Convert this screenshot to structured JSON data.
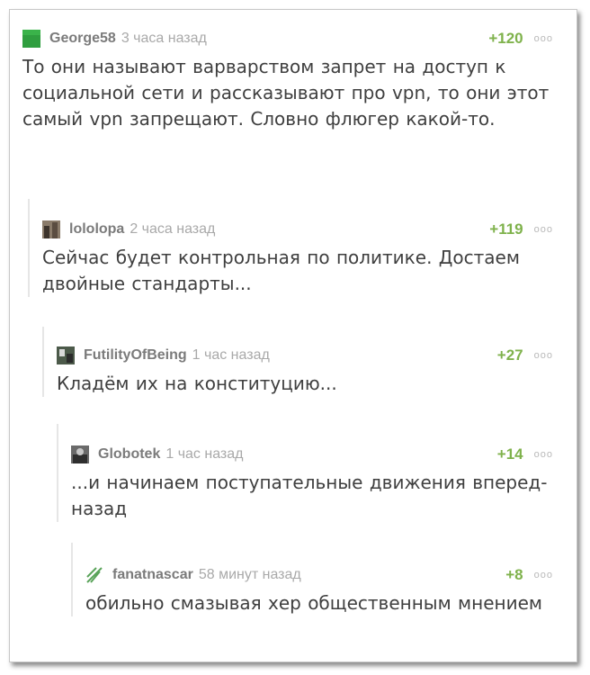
{
  "comments": [
    {
      "author": "George58",
      "time": "3 часа назад",
      "rating": "+120",
      "more_icon": "ooo",
      "avatar": "green-square-avatar",
      "text": "То они называют варварством запрет на доступ к социальной сети и рассказывают про vpn, то они этот самый vpn запрещают. Словно флюгер какой-то."
    },
    {
      "author": "lololopa",
      "time": "2 часа назад",
      "rating": "+119",
      "more_icon": "ooo",
      "avatar": "photo-avatar",
      "text": "Сейчас будет контрольная по политике. Достаем двойные стандарты..."
    },
    {
      "author": "FutilityOfBeing",
      "time": "1 час назад",
      "rating": "+27",
      "more_icon": "ooo",
      "avatar": "photo-avatar",
      "text": "Кладём их на конституцию..."
    },
    {
      "author": "Globotek",
      "time": "1 час назад",
      "rating": "+14",
      "more_icon": "ooo",
      "avatar": "photo-avatar",
      "text": "...и начинаем поступательные движения вперед-назад"
    },
    {
      "author": "fanatnascar",
      "time": "58 минут назад",
      "rating": "+8",
      "more_icon": "ooo",
      "avatar": "leaf-avatar",
      "text": "обильно смазывая хер общественным мнением"
    }
  ],
  "colors": {
    "rating": "#7fb24c",
    "author": "#7b7b7b",
    "time": "#a9a9a9",
    "text": "#3f3f3f",
    "thread_line": "#e6e6e6"
  }
}
